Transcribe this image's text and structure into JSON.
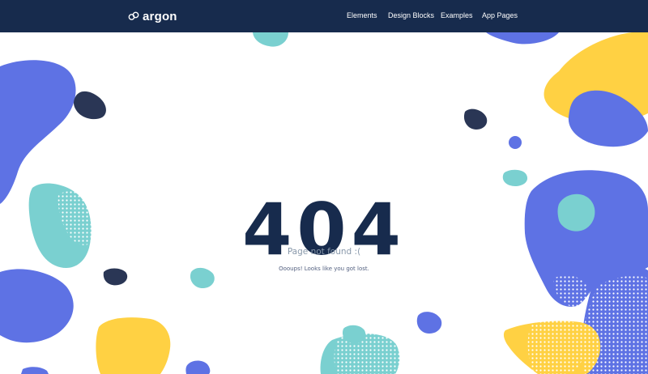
{
  "navbar": {
    "brand_name": "argon",
    "links": [
      "Elements",
      "Design Blocks",
      "Examples",
      "App Pages"
    ]
  },
  "error": {
    "code": "404",
    "title": "Page not found :(",
    "message": "Oooups! Looks like you got lost."
  },
  "colors": {
    "navbar": "#172b4d",
    "blob_indigo": "#5e72e4",
    "blob_teal": "#7ad0d0",
    "blob_yellow": "#ffd143",
    "blob_navy": "#2a3655",
    "text_dark": "#172b4d"
  }
}
